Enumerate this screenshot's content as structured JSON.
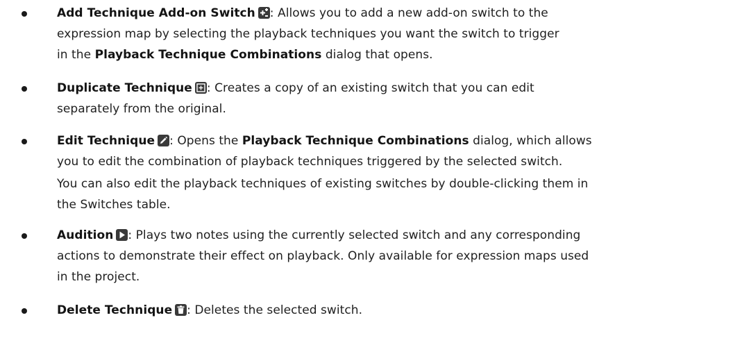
{
  "items": [
    {
      "icon": "add-on-switch-icon",
      "lines": [
        [
          {
            "b": "Add Technique Add-on Switch"
          },
          {
            "icon": true
          },
          {
            "t": ": Allows you to add a new add-on switch to the"
          }
        ],
        [
          {
            "t": "expression map by selecting the playback techniques you want the switch to trigger"
          }
        ],
        [
          {
            "t": "in the "
          },
          {
            "b": "Playback Technique Combinations"
          },
          {
            "t": " dialog that opens."
          }
        ]
      ]
    },
    {
      "icon": "duplicate-icon",
      "lines": [
        [
          {
            "b": "Duplicate Technique"
          },
          {
            "icon": true
          },
          {
            "t": ": Creates a copy of an existing switch that you can edit"
          }
        ],
        [
          {
            "t": "separately from the original."
          }
        ]
      ]
    },
    {
      "icon": "edit-pencil-icon",
      "lines": [
        [
          {
            "b": "Edit Technique"
          },
          {
            "icon": true
          },
          {
            "t": ": Opens the "
          },
          {
            "b": "Playback Technique Combinations"
          },
          {
            "t": " dialog, which allows"
          }
        ],
        [
          {
            "t": "you to edit the combination of playback techniques triggered by the selected switch."
          }
        ],
        [
          {
            "t": "You can also edit the playback techniques of existing switches by double-clicking them in"
          }
        ],
        [
          {
            "t": "the Switches table."
          }
        ]
      ]
    },
    {
      "icon": "play-icon",
      "lines": [
        [
          {
            "b": "Audition"
          },
          {
            "icon": true
          },
          {
            "t": ": Plays two notes using the currently selected switch and any corresponding"
          }
        ],
        [
          {
            "t": "actions to demonstrate their effect on playback. Only available for expression maps used"
          }
        ],
        [
          {
            "t": "in the project."
          }
        ]
      ]
    },
    {
      "icon": "trash-icon",
      "lines": [
        [
          {
            "b": "Delete Technique"
          },
          {
            "icon": true
          },
          {
            "t": ": Deletes the selected switch."
          }
        ]
      ]
    }
  ],
  "colors": {
    "text": "#1f1f1f",
    "icon_bg": "#3a3a3a",
    "icon_fg": "#ffffff"
  }
}
